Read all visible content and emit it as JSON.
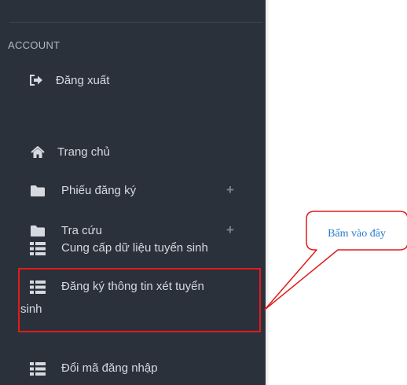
{
  "sidebar": {
    "section_label": "ACCOUNT",
    "items": [
      {
        "label": "Đăng xuất",
        "icon": "sign-out-icon"
      },
      {
        "label": "Trang chủ",
        "icon": "home-icon"
      },
      {
        "label": "Phiếu đăng ký",
        "icon": "folder-icon",
        "expand": "+"
      },
      {
        "label": "Tra cứu",
        "icon": "folder-icon",
        "expand": "+"
      },
      {
        "label": "Cung cấp dữ liệu tuyển sinh",
        "icon": "list-icon"
      },
      {
        "label_line1": "Đăng ký thông tin xét tuyển",
        "label_line2": "sinh",
        "icon": "list-icon"
      },
      {
        "label": "Đổi mã đăng nhập",
        "icon": "list-icon"
      }
    ]
  },
  "annotation": {
    "callout_text": "Bấm vào đây",
    "color": "#e21b1b",
    "text_color": "#2b7ec8"
  },
  "colors": {
    "sidebar_bg": "#2b313b",
    "text": "#d6dae0",
    "section_label": "#b3b9c2"
  }
}
